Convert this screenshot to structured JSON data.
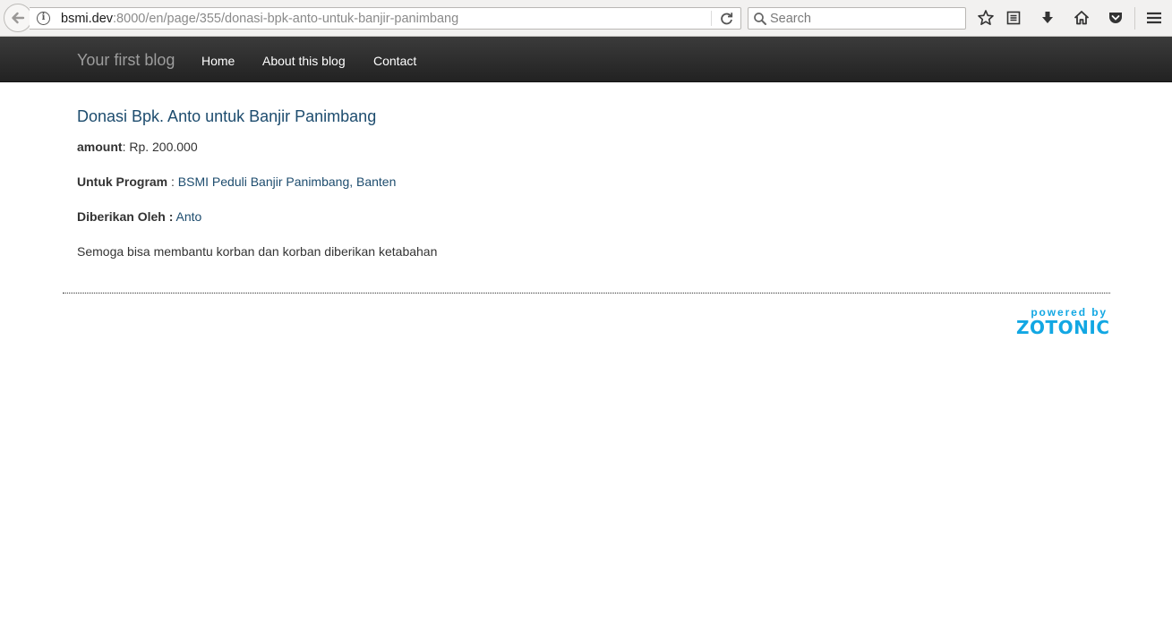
{
  "browser": {
    "url_host": "bsmi.dev",
    "url_rest": ":8000/en/page/355/donasi-bpk-anto-untuk-banjir-panimbang",
    "search_placeholder": "Search"
  },
  "navbar": {
    "brand": "Your first blog",
    "links": [
      {
        "label": "Home"
      },
      {
        "label": "About this blog"
      },
      {
        "label": "Contact"
      }
    ]
  },
  "page": {
    "title": "Donasi Bpk. Anto untuk Banjir Panimbang",
    "amount_label": "amount",
    "amount_value": ": Rp. 200.000",
    "program_label": "Untuk Program",
    "program_sep": " : ",
    "program_value": "BSMI Peduli Banjir Panimbang, Banten",
    "given_label": "Diberikan Oleh :",
    "given_value": "Anto",
    "body": "Semoga bisa membantu korban dan korban diberikan ketabahan"
  },
  "footer": {
    "powered_by": "powered by",
    "brand": "ZOTONIC"
  },
  "colors": {
    "navbar": "#222222",
    "link": "#1d4c6e",
    "zotonic": "#12a7e3"
  }
}
